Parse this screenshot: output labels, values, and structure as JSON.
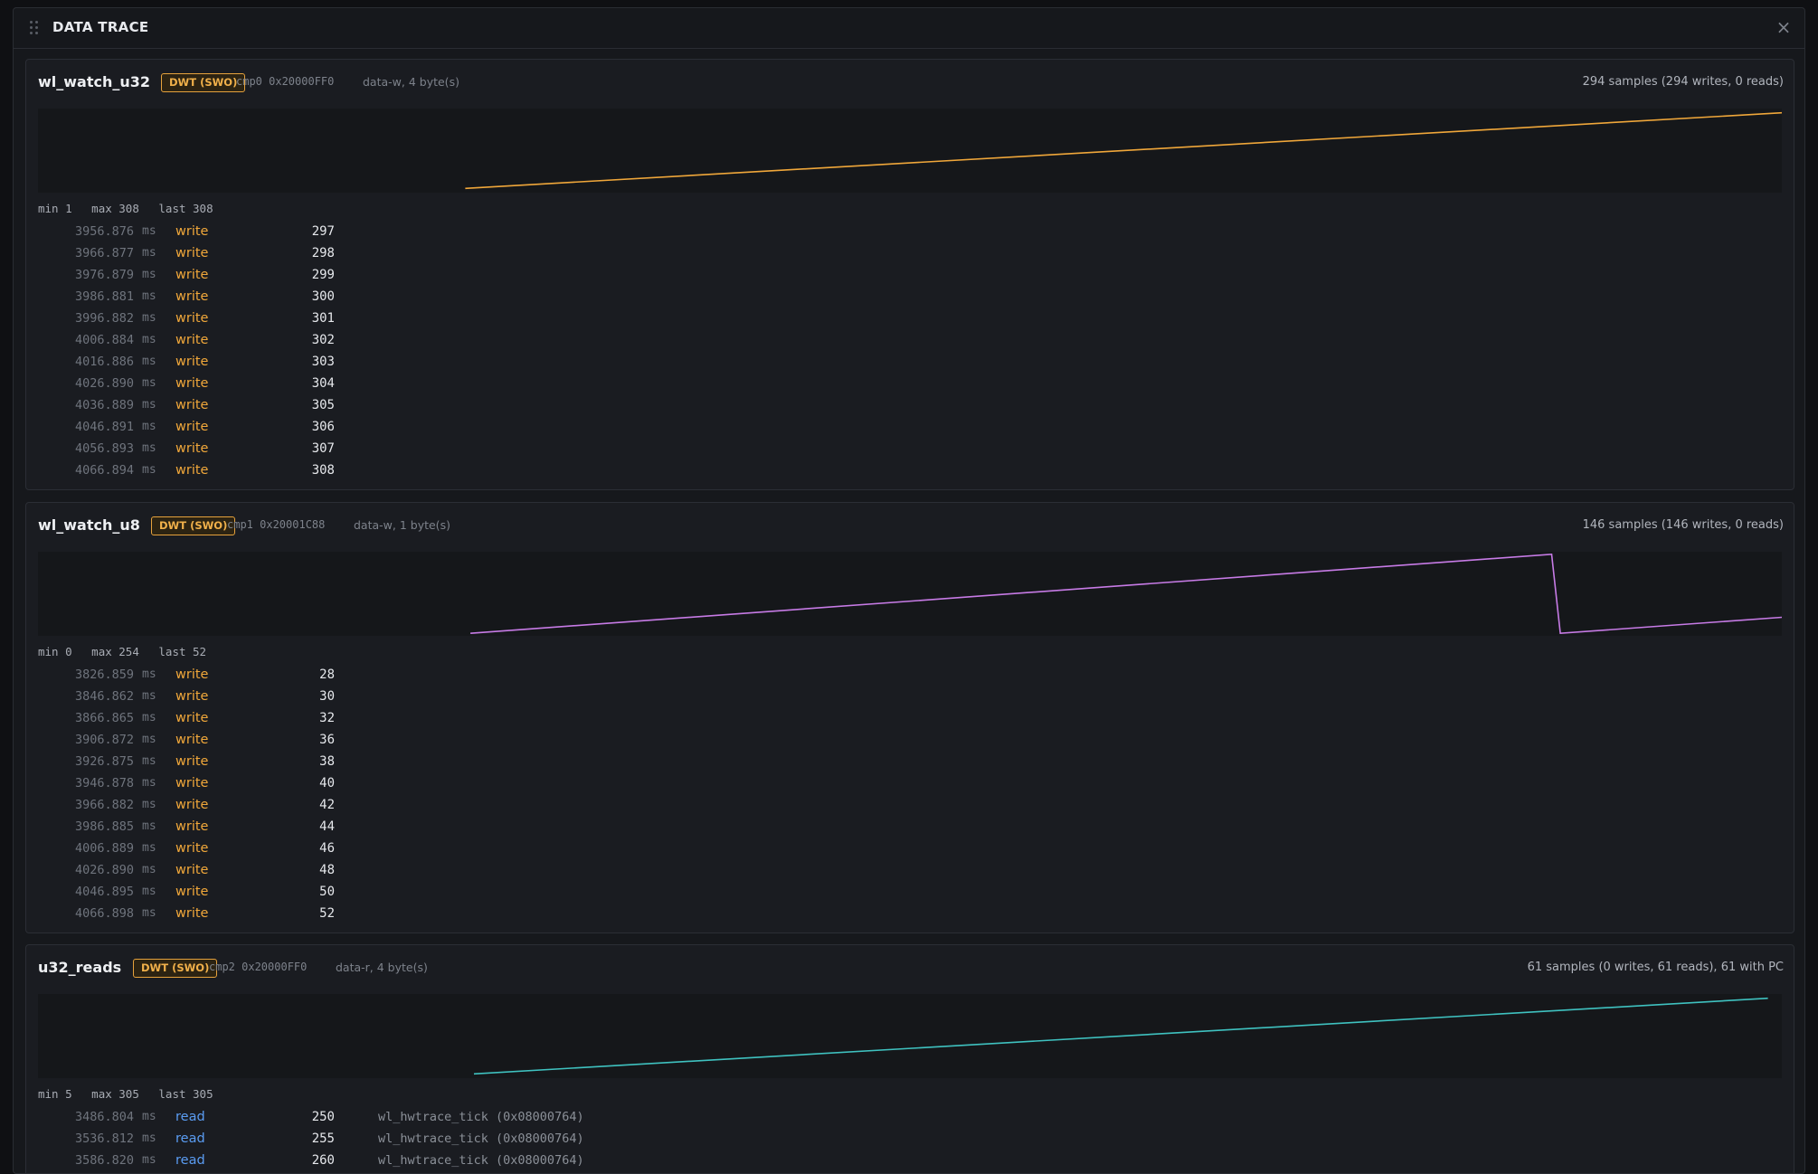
{
  "panel": {
    "title": "DATA TRACE",
    "close_label": "×"
  },
  "units": "ms",
  "cards": [
    {
      "name": "wl_watch_u32",
      "badge": "DWT (SWO)",
      "cmp": "cmp0 0x20000FF0",
      "kind": "data-w, 4 byte(s)",
      "samples": "294 samples (294 writes, 0 reads)",
      "color": "#f0a73a",
      "stats": {
        "min": "min 1",
        "max": "max 308",
        "last": "last 308"
      },
      "plot": {
        "x_range": [
          0,
          1
        ],
        "y_range": [
          0,
          1
        ],
        "points": [
          [
            0.245,
            0.05
          ],
          [
            1.0,
            0.95
          ]
        ]
      },
      "rows": [
        {
          "t": "3956.876",
          "op": "write",
          "v": "297"
        },
        {
          "t": "3966.877",
          "op": "write",
          "v": "298"
        },
        {
          "t": "3976.879",
          "op": "write",
          "v": "299"
        },
        {
          "t": "3986.881",
          "op": "write",
          "v": "300"
        },
        {
          "t": "3996.882",
          "op": "write",
          "v": "301"
        },
        {
          "t": "4006.884",
          "op": "write",
          "v": "302"
        },
        {
          "t": "4016.886",
          "op": "write",
          "v": "303"
        },
        {
          "t": "4026.890",
          "op": "write",
          "v": "304"
        },
        {
          "t": "4036.889",
          "op": "write",
          "v": "305"
        },
        {
          "t": "4046.891",
          "op": "write",
          "v": "306"
        },
        {
          "t": "4056.893",
          "op": "write",
          "v": "307"
        },
        {
          "t": "4066.894",
          "op": "write",
          "v": "308"
        }
      ]
    },
    {
      "name": "wl_watch_u8",
      "badge": "DWT (SWO)",
      "cmp": "cmp1 0x20001C88",
      "kind": "data-w, 1 byte(s)",
      "samples": "146 samples (146 writes, 0 reads)",
      "color": "#c77be6",
      "stats": {
        "min": "min 0",
        "max": "max 254",
        "last": "last 52"
      },
      "plot": {
        "x_range": [
          0,
          1
        ],
        "y_range": [
          0,
          1
        ],
        "points": [
          [
            0.248,
            0.03
          ],
          [
            0.868,
            0.97
          ],
          [
            0.873,
            0.03
          ],
          [
            1.0,
            0.22
          ]
        ]
      },
      "rows": [
        {
          "t": "3826.859",
          "op": "write",
          "v": "28"
        },
        {
          "t": "3846.862",
          "op": "write",
          "v": "30"
        },
        {
          "t": "3866.865",
          "op": "write",
          "v": "32"
        },
        {
          "t": "3906.872",
          "op": "write",
          "v": "36"
        },
        {
          "t": "3926.875",
          "op": "write",
          "v": "38"
        },
        {
          "t": "3946.878",
          "op": "write",
          "v": "40"
        },
        {
          "t": "3966.882",
          "op": "write",
          "v": "42"
        },
        {
          "t": "3986.885",
          "op": "write",
          "v": "44"
        },
        {
          "t": "4006.889",
          "op": "write",
          "v": "46"
        },
        {
          "t": "4026.890",
          "op": "write",
          "v": "48"
        },
        {
          "t": "4046.895",
          "op": "write",
          "v": "50"
        },
        {
          "t": "4066.898",
          "op": "write",
          "v": "52"
        }
      ]
    },
    {
      "name": "u32_reads",
      "badge": "DWT (SWO)",
      "cmp": "cmp2 0x20000FF0",
      "kind": "data-r, 4 byte(s)",
      "samples": "61 samples (0 writes, 61 reads), 61 with PC",
      "color": "#3fc2c0",
      "stats": {
        "min": "min 5",
        "max": "max 305",
        "last": "last 305"
      },
      "plot": {
        "x_range": [
          0,
          1
        ],
        "y_range": [
          0,
          1
        ],
        "points": [
          [
            0.25,
            0.05
          ],
          [
            0.992,
            0.95
          ]
        ]
      },
      "rows": [
        {
          "t": "3486.804",
          "op": "read",
          "v": "250",
          "pc": "wl_hwtrace_tick (0x08000764)"
        },
        {
          "t": "3536.812",
          "op": "read",
          "v": "255",
          "pc": "wl_hwtrace_tick (0x08000764)"
        },
        {
          "t": "3586.820",
          "op": "read",
          "v": "260",
          "pc": "wl_hwtrace_tick (0x08000764)"
        }
      ]
    }
  ]
}
